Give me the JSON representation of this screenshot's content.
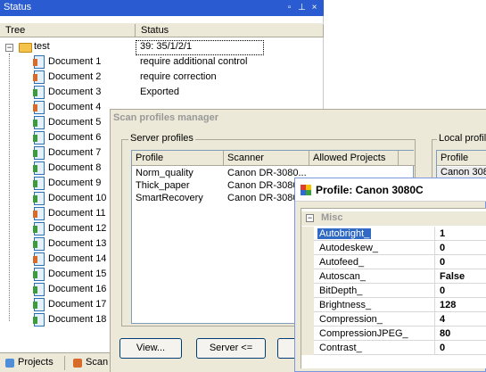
{
  "status_panel": {
    "title": "Status",
    "columns": {
      "tree": "Tree",
      "status": "Status"
    },
    "root": {
      "name": "test",
      "status": "39: 35/1/2/1"
    },
    "documents": [
      {
        "name": "Document  1",
        "status": "require additional control",
        "tag_color": "#d86a2a"
      },
      {
        "name": "Document  2",
        "status": "require correction",
        "tag_color": "#d86a2a"
      },
      {
        "name": "Document  3",
        "status": "Exported",
        "tag_color": "#3c9b3c"
      },
      {
        "name": "Document  4",
        "status": "",
        "tag_color": "#d86a2a"
      },
      {
        "name": "Document  5",
        "status": "",
        "tag_color": "#3c9b3c"
      },
      {
        "name": "Document  6",
        "status": "",
        "tag_color": "#3c9b3c"
      },
      {
        "name": "Document  7",
        "status": "",
        "tag_color": "#3c9b3c"
      },
      {
        "name": "Document  8",
        "status": "",
        "tag_color": "#3c9b3c"
      },
      {
        "name": "Document  9",
        "status": "",
        "tag_color": "#3c9b3c"
      },
      {
        "name": "Document 10",
        "status": "",
        "tag_color": "#3c9b3c"
      },
      {
        "name": "Document 11",
        "status": "",
        "tag_color": "#d86a2a"
      },
      {
        "name": "Document 12",
        "status": "",
        "tag_color": "#3c9b3c"
      },
      {
        "name": "Document 13",
        "status": "",
        "tag_color": "#3c9b3c"
      },
      {
        "name": "Document 14",
        "status": "",
        "tag_color": "#d86a2a"
      },
      {
        "name": "Document 15",
        "status": "",
        "tag_color": "#3c9b3c"
      },
      {
        "name": "Document 16",
        "status": "",
        "tag_color": "#3c9b3c"
      },
      {
        "name": "Document 17",
        "status": "",
        "tag_color": "#3c9b3c"
      },
      {
        "name": "Document 18",
        "status": "",
        "tag_color": "#3c9b3c"
      }
    ],
    "tabs": {
      "projects": "Projects",
      "scan": "Scan"
    }
  },
  "scan_manager": {
    "title": "Scan profiles manager",
    "server_group": "Server profiles",
    "local_group": "Local profile",
    "columns": {
      "profile": "Profile",
      "scanner": "Scanner",
      "allowed": "Allowed Projects"
    },
    "profiles": [
      {
        "profile": "Norm_quality",
        "scanner": "Canon DR-3080..."
      },
      {
        "profile": "Thick_paper",
        "scanner": "Canon DR-3080C"
      },
      {
        "profile": "SmartRecovery",
        "scanner": "Canon DR-3080C"
      }
    ],
    "local_column": "Profile",
    "local_row": "Canon 308",
    "buttons": {
      "view": "View...",
      "server": "Server <=",
      "extra": ""
    }
  },
  "profile_window": {
    "title": "Profile: Canon 3080C",
    "category": "Misc",
    "properties": [
      {
        "key": "Autobright_",
        "value": "1"
      },
      {
        "key": "Autodeskew_",
        "value": "0"
      },
      {
        "key": "Autofeed_",
        "value": "0"
      },
      {
        "key": "Autoscan_",
        "value": "False"
      },
      {
        "key": "BitDepth_",
        "value": "0"
      },
      {
        "key": "Brightness_",
        "value": "128"
      },
      {
        "key": "Compression_",
        "value": "4"
      },
      {
        "key": "CompressionJPEG_",
        "value": "80"
      },
      {
        "key": "Contrast_",
        "value": "0"
      }
    ]
  }
}
